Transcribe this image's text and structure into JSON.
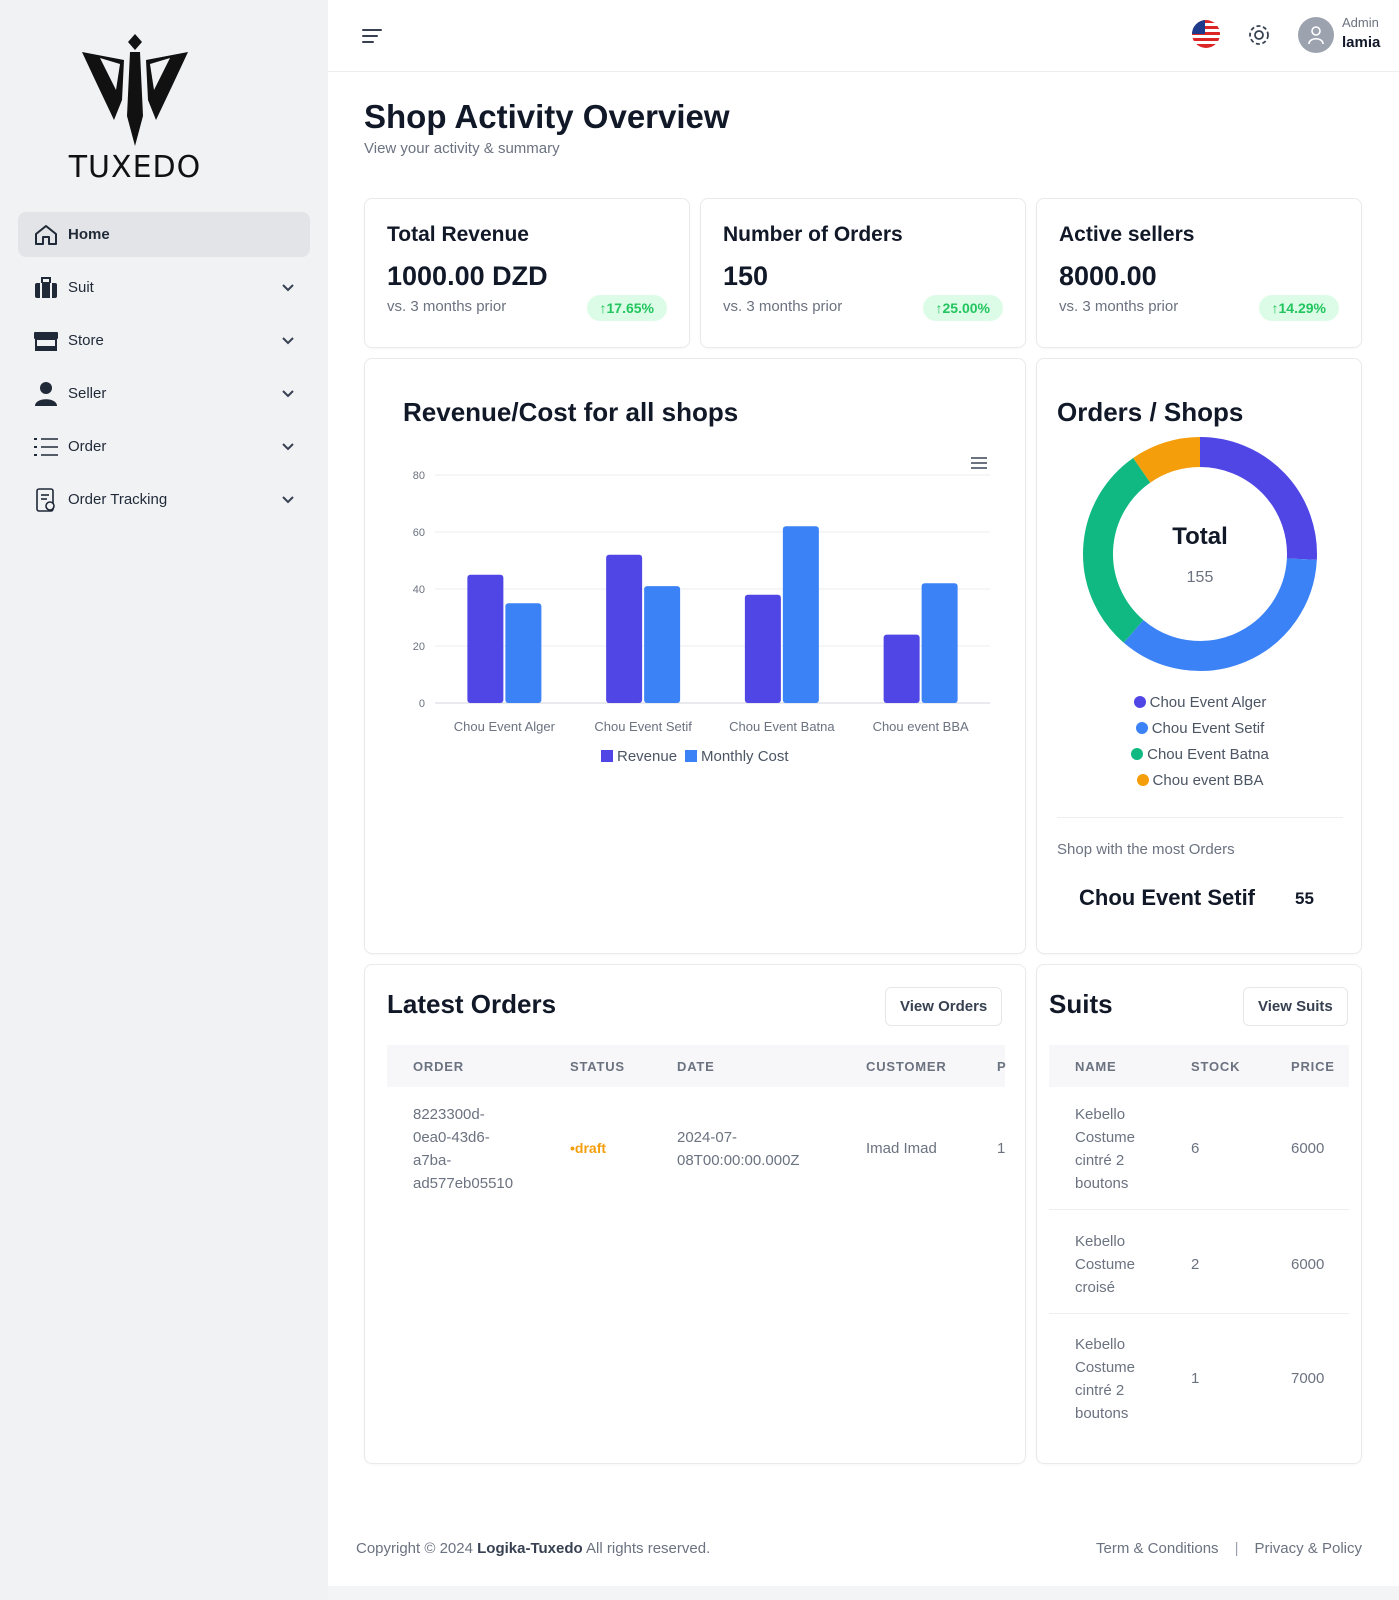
{
  "brand": {
    "name": "TUXEDO"
  },
  "sidebar": {
    "items": [
      {
        "label": "Home",
        "icon": "home-icon",
        "active": true
      },
      {
        "label": "Suit",
        "icon": "suitcase-icon"
      },
      {
        "label": "Store",
        "icon": "store-icon"
      },
      {
        "label": "Seller",
        "icon": "user-icon"
      },
      {
        "label": "Order",
        "icon": "list-icon"
      },
      {
        "label": "Order Tracking",
        "icon": "tracking-icon"
      }
    ]
  },
  "topbar": {
    "user_role": "Admin",
    "user_name": "lamia"
  },
  "page": {
    "title": "Shop Activity Overview",
    "subtitle": "View your activity & summary"
  },
  "stats": [
    {
      "title": "Total Revenue",
      "value": "1000.00 DZD",
      "sub": "vs. 3 months prior",
      "badge": "↑17.65%"
    },
    {
      "title": "Number of Orders",
      "value": "150",
      "sub": "vs. 3 months prior",
      "badge": "↑25.00%"
    },
    {
      "title": "Active sellers",
      "value": "8000.00",
      "sub": "vs. 3 months prior",
      "badge": "↑14.29%"
    }
  ],
  "colors": {
    "revenue": "#4f46e5",
    "monthly_cost": "#3b82f6",
    "alger": "#4f46e5",
    "setif": "#3b82f6",
    "batna": "#10b981",
    "bba": "#f59e0b",
    "badge_green": "#22c55e",
    "draft": "#f59e0b"
  },
  "chart_data": [
    {
      "type": "bar",
      "title": "Revenue/Cost for all shops",
      "categories": [
        "Chou Event Alger",
        "Chou Event Setif",
        "Chou Event Batna",
        "Chou event BBA"
      ],
      "series": [
        {
          "name": "Revenue",
          "values": [
            45,
            52,
            38,
            24
          ]
        },
        {
          "name": "Monthly Cost",
          "values": [
            35,
            41,
            62,
            42
          ]
        }
      ],
      "ylim": [
        0,
        80
      ],
      "yticks": [
        "0",
        "20",
        "40",
        "60",
        "80"
      ],
      "grid": true,
      "legend": "bottom"
    },
    {
      "type": "pie",
      "title": "Orders / Shops",
      "center_label": "Total",
      "center_value": "155",
      "labels": [
        "Chou Event Alger",
        "Chou Event Setif",
        "Chou Event Batna",
        "Chou event BBA"
      ],
      "values": [
        40,
        55,
        45,
        15
      ],
      "legend": "bottom"
    }
  ],
  "orders_shops": {
    "most_label": "Shop with the most Orders",
    "most_shop": "Chou Event Setif",
    "most_value": "55"
  },
  "latest_orders": {
    "title": "Latest Orders",
    "button": "View Orders",
    "columns": [
      "ORDER",
      "STATUS",
      "DATE",
      "CUSTOMER",
      "P"
    ],
    "rows": [
      {
        "order": [
          "8223300d-",
          "0ea0-43d6-",
          "a7ba-",
          "ad577eb05510"
        ],
        "status": "•draft",
        "date": [
          "2024-07-",
          "08T00:00:00.000Z"
        ],
        "customer": "Imad Imad",
        "p": "1"
      }
    ]
  },
  "suits": {
    "title": "Suits",
    "button": "View Suits",
    "columns": [
      "NAME",
      "STOCK",
      "PRICE"
    ],
    "rows": [
      {
        "name": [
          "Kebello",
          "Costume",
          "cintré 2",
          "boutons"
        ],
        "stock": "6",
        "price": "6000"
      },
      {
        "name": [
          "Kebello",
          "Costume",
          "croisé"
        ],
        "stock": "2",
        "price": "6000"
      },
      {
        "name": [
          "Kebello",
          "Costume",
          "cintré 2",
          "boutons"
        ],
        "stock": "1",
        "price": "7000"
      }
    ]
  },
  "footer": {
    "prefix": "Copyright © 2024",
    "company": "Logika-Tuxedo",
    "suffix": "All rights reserved.",
    "terms": "Term & Conditions",
    "sep": "|",
    "privacy": "Privacy & Policy"
  }
}
